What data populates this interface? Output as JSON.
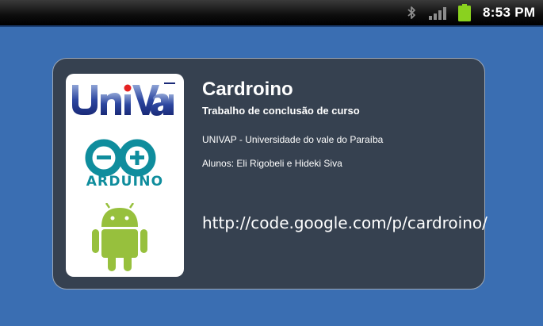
{
  "status_bar": {
    "time": "8:53 PM",
    "icons": [
      "bluetooth-icon",
      "signal-strength-icon",
      "battery-icon"
    ],
    "battery_color": "#8ad11f"
  },
  "card": {
    "title": "Cardroino",
    "subtitle": "Trabalho de conclusão de curso",
    "university": "UNIVAP - Universidade do vale do Paraíba",
    "students": "Alunos: Eli Rigobeli e Hideki Siva",
    "link": "http://code.google.com/p/cardroino/"
  },
  "logos": {
    "univap": "UniVap",
    "arduino": "ARDUINO",
    "android": "android-robot-icon"
  },
  "colors": {
    "background": "#3a6eb2",
    "card": "#364150",
    "arduino": "#0f8d9d",
    "android": "#97c03d",
    "univap_blue": "#1f3a8f",
    "univap_red": "#e52222"
  }
}
